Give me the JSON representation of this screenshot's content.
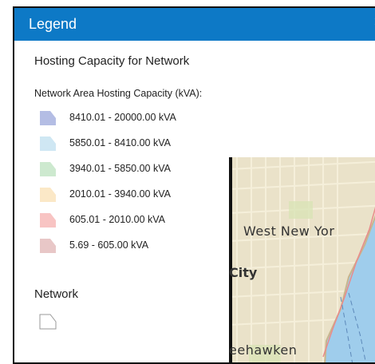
{
  "legend": {
    "title": "Legend",
    "close_glyph": "×",
    "layer_title": "Hosting Capacity for Network",
    "layer_subtitle": "Network Area Hosting Capacity (kVA):",
    "items": [
      {
        "label": "8410.01 - 20000.00 kVA",
        "color": "#b4bde4"
      },
      {
        "label": "5850.01 - 8410.00 kVA",
        "color": "#cfe7f3"
      },
      {
        "label": "3940.01 - 5850.00 kVA",
        "color": "#cde9cf"
      },
      {
        "label": "2010.01 - 3940.00 kVA",
        "color": "#fbe8c7"
      },
      {
        "label": "605.01 - 2010.00 kVA",
        "color": "#f8c4c3"
      },
      {
        "label": "5.69 - 605.00 kVA",
        "color": "#e8c7c7"
      }
    ],
    "network_title": "Network",
    "network_icon": "polygon-outline-icon"
  },
  "map": {
    "labels": [
      "West New Yor",
      "City",
      "eehawken"
    ]
  }
}
